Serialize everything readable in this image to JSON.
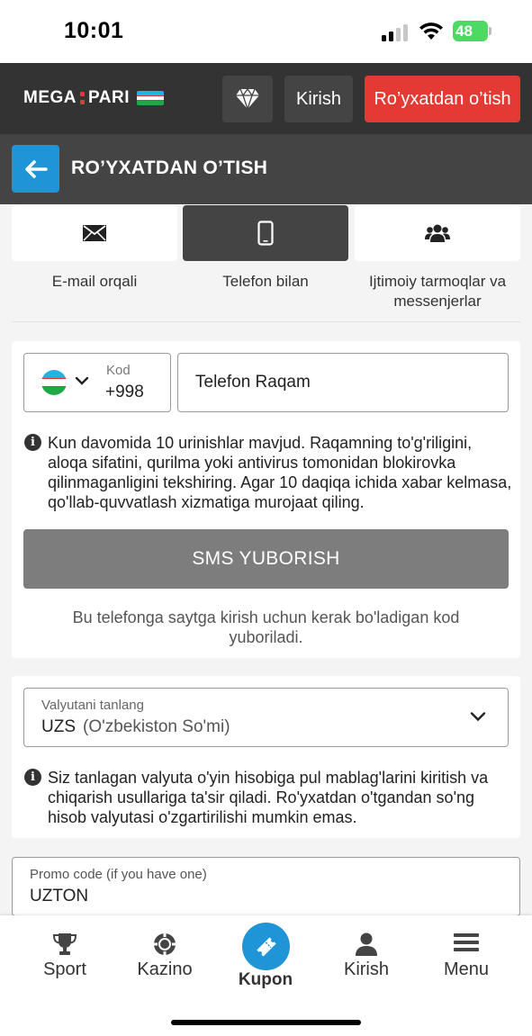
{
  "status_bar": {
    "time": "10:01",
    "battery": "48"
  },
  "header": {
    "logo_left": "MEGA",
    "logo_right": "PARI",
    "login_label": "Kirish",
    "register_label": "Ro’yxatdan o’tish"
  },
  "page": {
    "title": "RO’YXATDAN O’TISH"
  },
  "tabs": [
    {
      "label": "E-mail orqali",
      "icon": "envelope-icon",
      "active": false
    },
    {
      "label": "Telefon bilan",
      "icon": "phone-icon",
      "active": true
    },
    {
      "label": "Ijtimoiy tarmoqlar va messenjerlar",
      "icon": "users-icon",
      "active": false
    }
  ],
  "phone_form": {
    "code_label": "Kod",
    "code_value": "+998",
    "phone_placeholder": "Telefon Raqam",
    "info_text": "Kun davomida 10 urinishlar mavjud. Raqamning to'g'riligini, aloqa sifatini, qurilma yoki antivirus tomonidan blokirovka qilinmaganligini tekshiring. Agar 10 daqiqa ichida xabar kelmasa, qo'llab-quvvatlash xizmatiga murojaat qiling.",
    "sms_button": "SMS YUBORISH",
    "sms_note": "Bu telefonga saytga kirish uchun kerak bo'ladigan kod yuboriladi."
  },
  "currency": {
    "label": "Valyutani tanlang",
    "code": "UZS",
    "name": "(O'zbekiston So'mi)",
    "info_text": "Siz tanlagan valyuta o'yin hisobiga pul mablag'larini kiritish va chiqarish usullariga ta'sir qiladi. Ro'yxatdan o'tgandan so'ng hisob valyutasi o'zgartirilishi mumkin emas."
  },
  "promo": {
    "label": "Promo code (if you have one)",
    "value": "UZTON"
  },
  "bottom_nav": [
    {
      "label": "Sport",
      "icon": "trophy-icon"
    },
    {
      "label": "Kazino",
      "icon": "casino-chip-icon"
    },
    {
      "label": "Kupon",
      "icon": "ticket-icon",
      "active": true
    },
    {
      "label": "Kirish",
      "icon": "user-icon"
    },
    {
      "label": "Menu",
      "icon": "hamburger-menu-icon"
    }
  ],
  "colors": {
    "accent_blue": "#1f94d6",
    "register_red": "#e33b34",
    "header_dark": "#333333",
    "subheader_dark": "#444444",
    "battery_green": "#4cd964"
  }
}
